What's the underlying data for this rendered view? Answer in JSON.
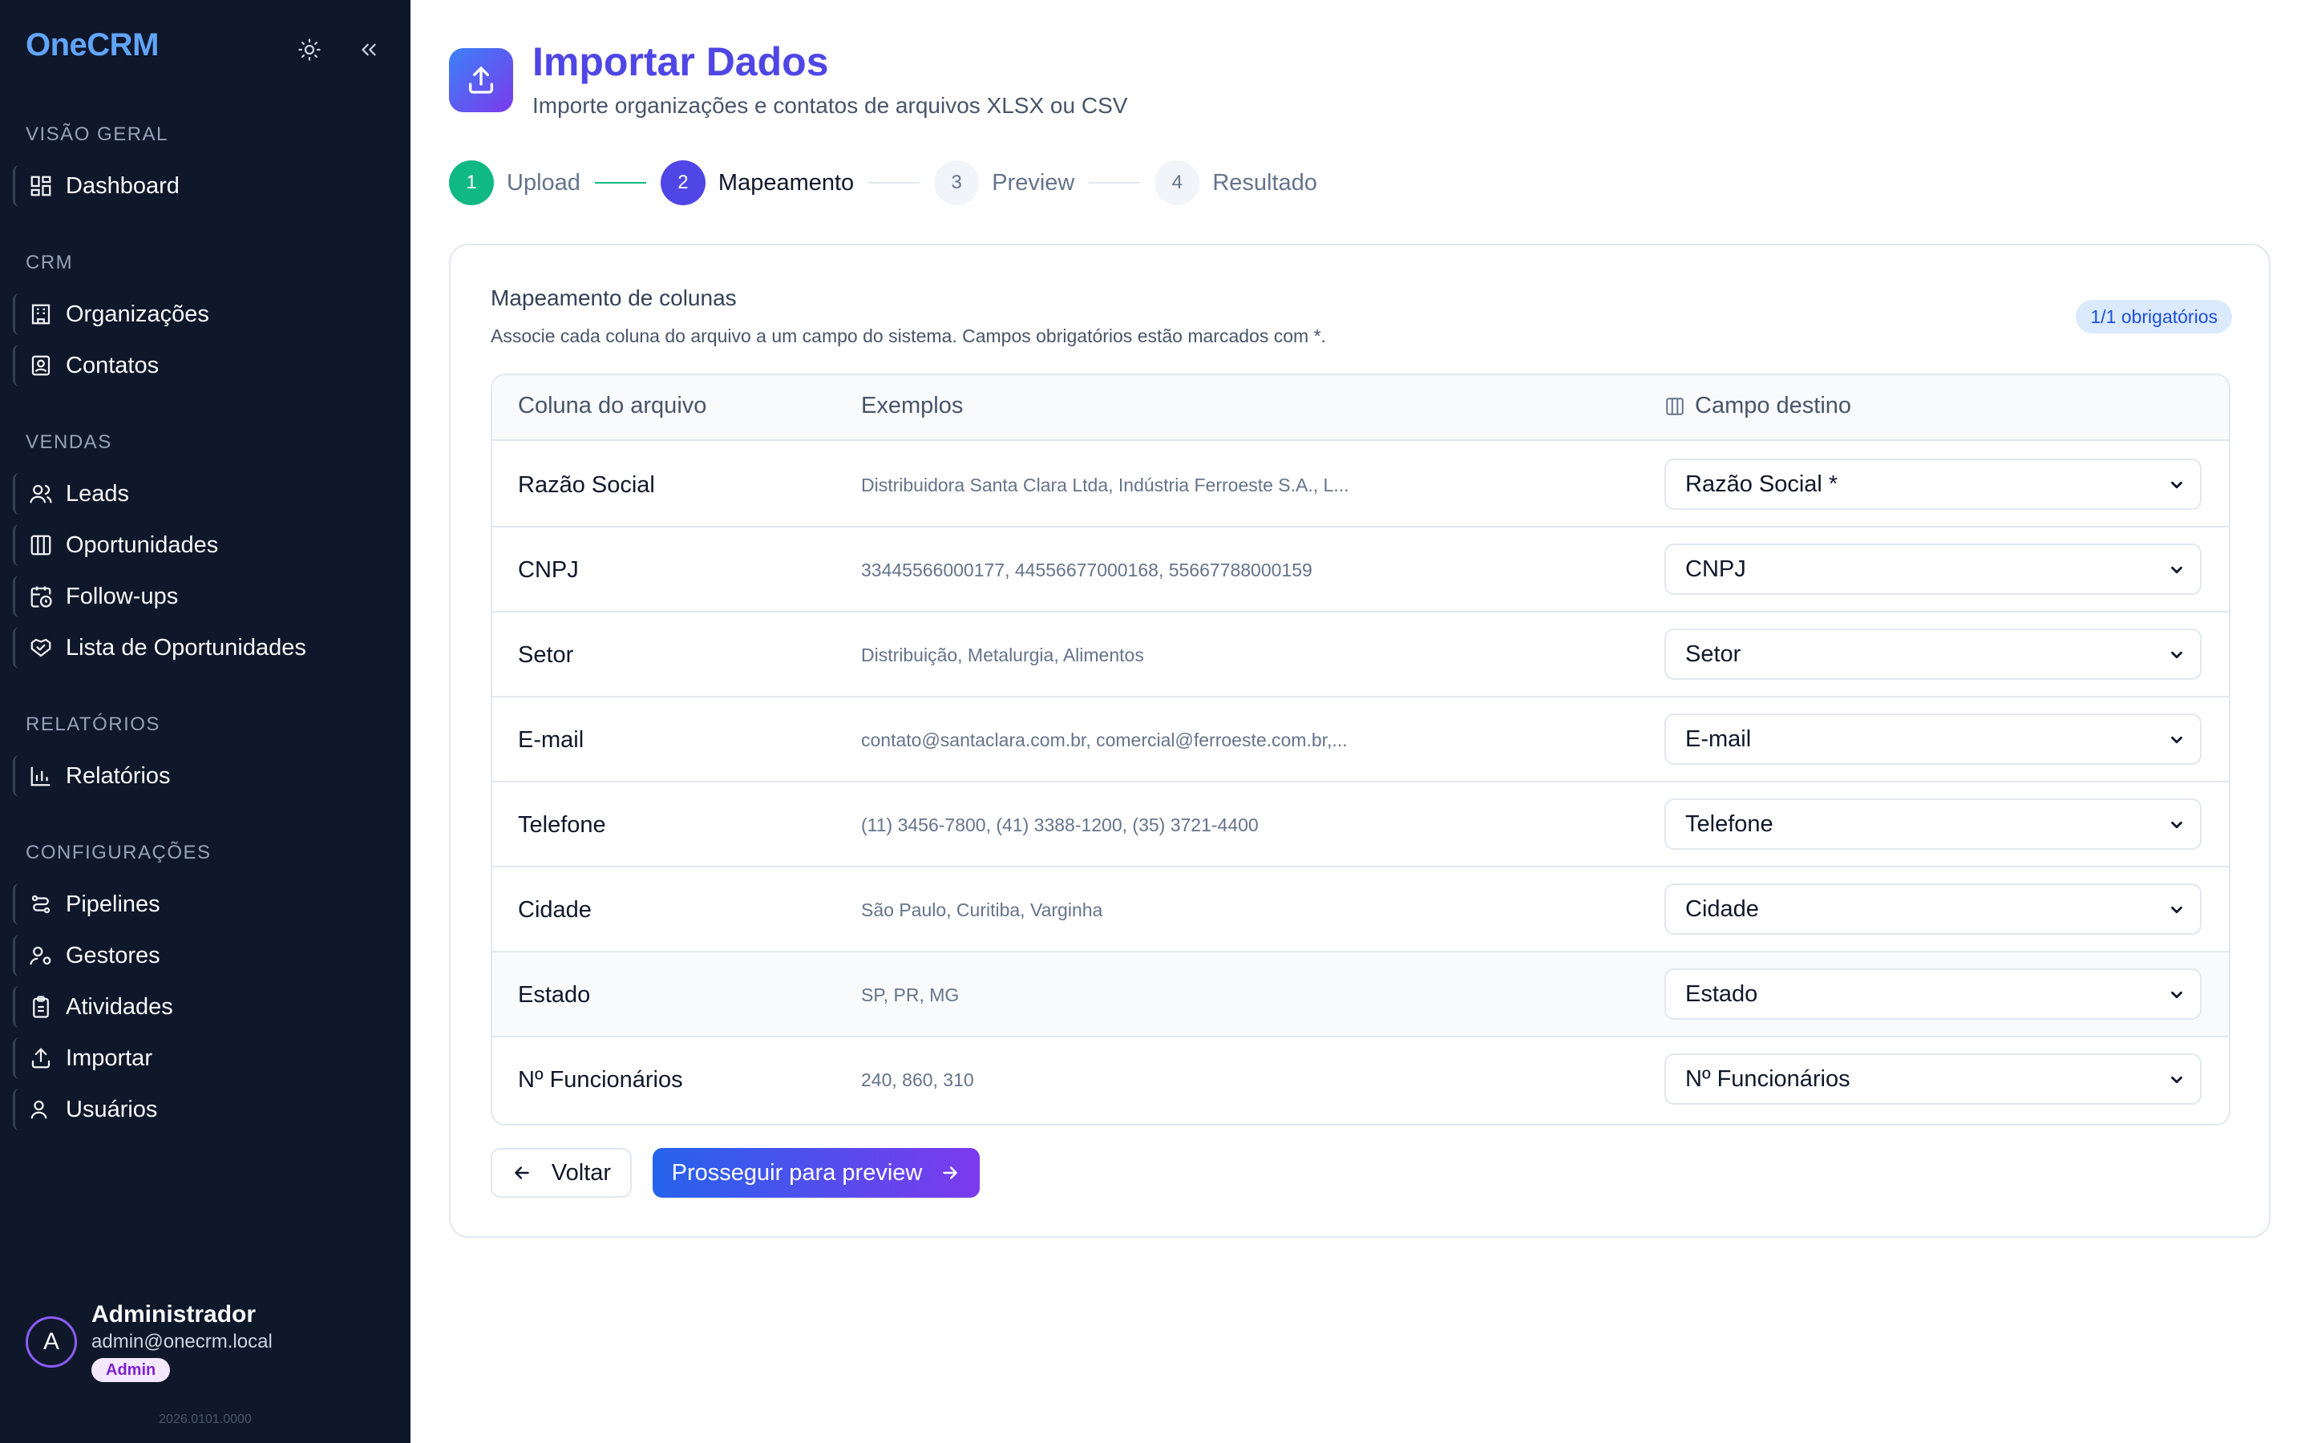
{
  "sidebar": {
    "brand": "OneCRM",
    "sections": [
      {
        "title": "VISÃO GERAL",
        "items": [
          {
            "label": "Dashboard",
            "icon": "dashboard-icon"
          }
        ]
      },
      {
        "title": "CRM",
        "items": [
          {
            "label": "Organizações",
            "icon": "building-icon"
          },
          {
            "label": "Contatos",
            "icon": "contact-icon"
          }
        ]
      },
      {
        "title": "VENDAS",
        "items": [
          {
            "label": "Leads",
            "icon": "users-icon"
          },
          {
            "label": "Oportunidades",
            "icon": "columns-icon"
          },
          {
            "label": "Follow-ups",
            "icon": "calendar-clock-icon"
          },
          {
            "label": "Lista de Oportunidades",
            "icon": "handshake-icon"
          }
        ]
      },
      {
        "title": "RELATÓRIOS",
        "items": [
          {
            "label": "Relatórios",
            "icon": "bar-chart-icon"
          }
        ]
      },
      {
        "title": "CONFIGURAÇÕES",
        "items": [
          {
            "label": "Pipelines",
            "icon": "route-icon"
          },
          {
            "label": "Gestores",
            "icon": "user-cog-icon"
          },
          {
            "label": "Atividades",
            "icon": "clipboard-icon"
          },
          {
            "label": "Importar",
            "icon": "upload-icon"
          },
          {
            "label": "Usuários",
            "icon": "users-icon"
          }
        ]
      }
    ],
    "user": {
      "initial": "A",
      "name": "Administrador",
      "email": "admin@onecrm.local",
      "role": "Admin"
    },
    "version": "2026.0101.0000"
  },
  "header": {
    "title": "Importar Dados",
    "subtitle": "Importe organizações e contatos de arquivos XLSX ou CSV"
  },
  "stepper": [
    {
      "number": "1",
      "label": "Upload",
      "state": "done"
    },
    {
      "number": "2",
      "label": "Mapeamento",
      "state": "active"
    },
    {
      "number": "3",
      "label": "Preview",
      "state": "pending"
    },
    {
      "number": "4",
      "label": "Resultado",
      "state": "pending"
    }
  ],
  "mapping": {
    "title": "Mapeamento de colunas",
    "description": "Associe cada coluna do arquivo a um campo do sistema. Campos obrigatórios estão marcados com *.",
    "required_badge": "1/1 obrigatórios",
    "columns": {
      "file": "Coluna do arquivo",
      "examples": "Exemplos",
      "destination": "Campo destino"
    },
    "rows": [
      {
        "file": "Razão Social",
        "examples": "Distribuidora Santa Clara Ltda, Indústria Ferroeste S.A., L...",
        "destination": "Razão Social *"
      },
      {
        "file": "CNPJ",
        "examples": "33445566000177, 44556677000168, 55667788000159",
        "destination": "CNPJ"
      },
      {
        "file": "Setor",
        "examples": "Distribuição, Metalurgia, Alimentos",
        "destination": "Setor"
      },
      {
        "file": "E-mail",
        "examples": "contato@santaclara.com.br, comercial@ferroeste.com.br,...",
        "destination": "E-mail"
      },
      {
        "file": "Telefone",
        "examples": "(11) 3456-7800, (41) 3388-1200, (35) 3721-4400",
        "destination": "Telefone"
      },
      {
        "file": "Cidade",
        "examples": "São Paulo, Curitiba, Varginha",
        "destination": "Cidade"
      },
      {
        "file": "Estado",
        "examples": "SP, PR, MG",
        "destination": "Estado"
      },
      {
        "file": "Nº Funcionários",
        "examples": "240, 860, 310",
        "destination": "Nº Funcionários"
      }
    ],
    "back_label": "Voltar",
    "next_label": "Prosseguir para preview"
  },
  "colors": {
    "sidebar_bg": "#0f172a",
    "brand": "#60a5fa",
    "accent": "#4f46e5",
    "success": "#10b981"
  }
}
